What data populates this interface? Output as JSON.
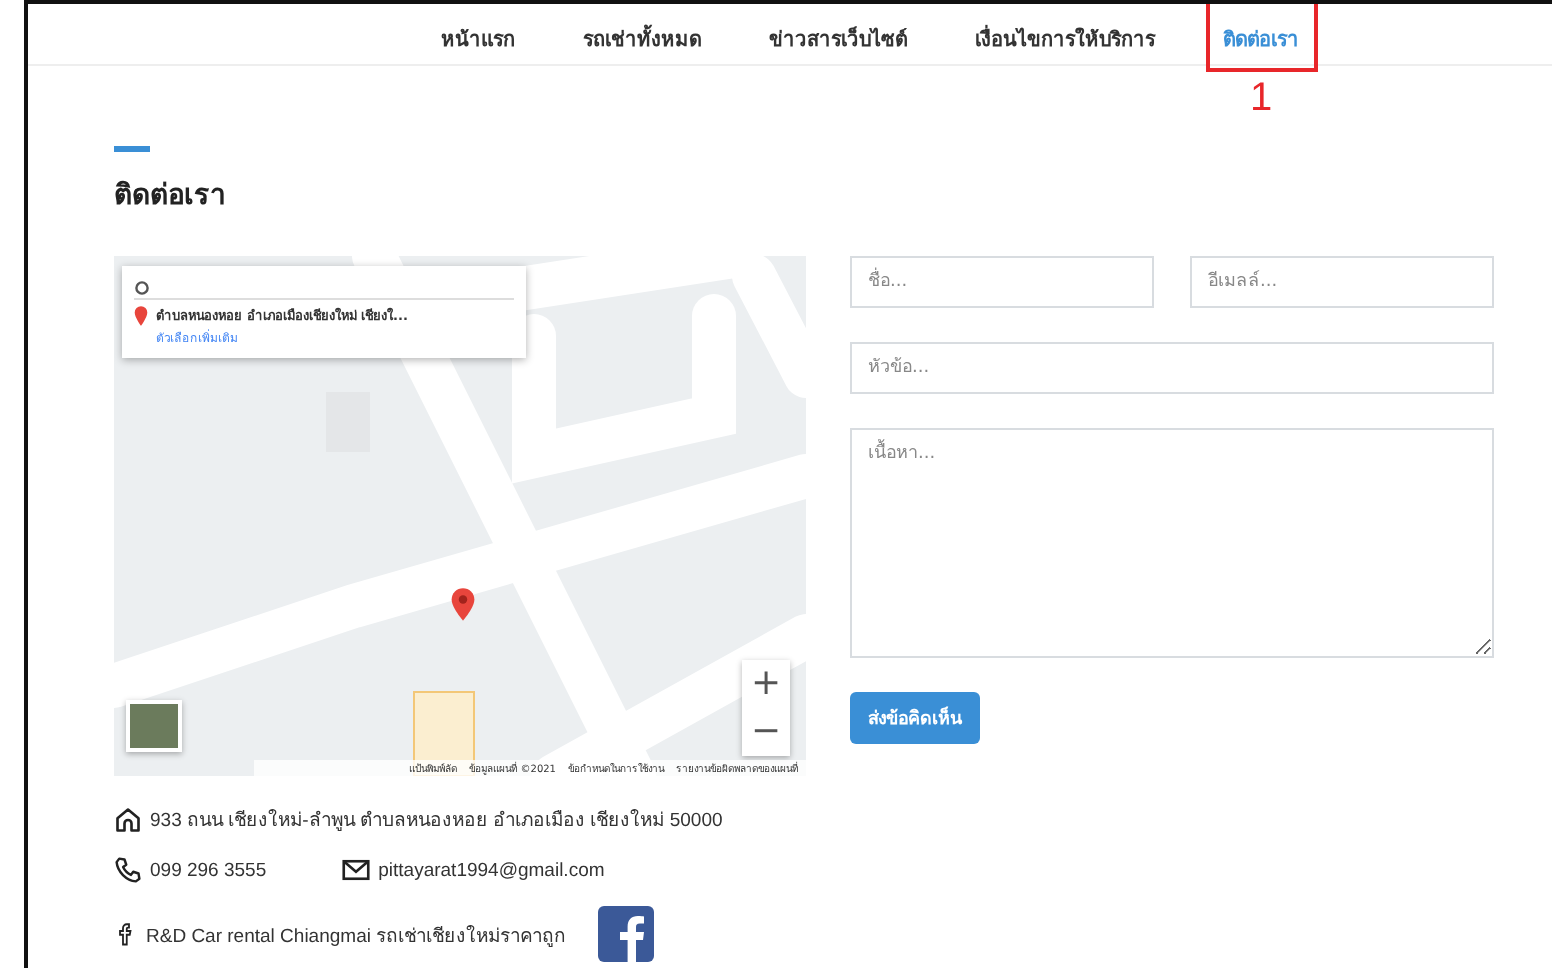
{
  "nav": {
    "items": [
      {
        "label": "หน้าแรก",
        "selected": false
      },
      {
        "label": "รถเช่าทั้งหมด",
        "selected": false
      },
      {
        "label": "ข่าวสารเว็บไซต์",
        "selected": false
      },
      {
        "label": "เงื่อนไขการให้บริการ",
        "selected": false
      },
      {
        "label": "ติดต่อเรา",
        "selected": true
      }
    ]
  },
  "annotation": {
    "number": "1"
  },
  "heading": "ติดต่อเรา",
  "map": {
    "info_card": {
      "place": "ตำบลหนองหอย อำเภอเมืองเชียงใหม่ เชียงใ...",
      "link": "ตัวเลือกเพิ่มเติม"
    },
    "zoom_in": "+",
    "zoom_out": "−",
    "attribution": [
      "แป้นพิมพ์ลัด",
      "ข้อมูลแผนที่ ©2021",
      "ข้อกำหนดในการใช้งาน",
      "รายงานข้อผิดพลาดของแผนที่"
    ]
  },
  "form": {
    "name": {
      "placeholder": "ชื่อ..."
    },
    "email": {
      "placeholder": "อีเมลล์..."
    },
    "subject": {
      "placeholder": "หัวข้อ..."
    },
    "message": {
      "placeholder": "เนื้อหา..."
    },
    "submit": "ส่งข้อคิดเห็น"
  },
  "contact": {
    "address": "933 ถนน เชียงใหม่-ลำพูน ตำบลหนองหอย อำเภอเมือง เชียงใหม่ 50000",
    "phone": "099 296 3555",
    "email": "pittayarat1994@gmail.com",
    "facebook": "R&D Car rental Chiangmai รถเช่าเชียงใหม่ราคาถูก"
  }
}
